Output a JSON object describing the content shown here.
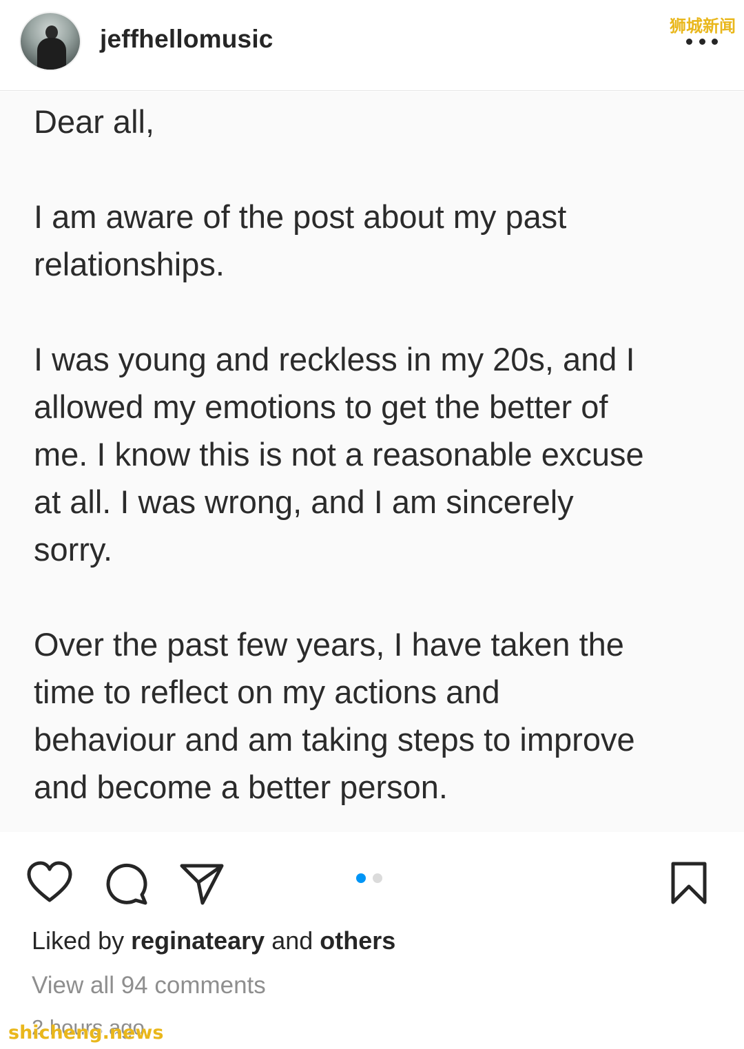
{
  "header": {
    "username": "jeffhellomusic",
    "watermark": "狮城新闻"
  },
  "post": {
    "text": "Dear all,\n\nI am aware of the post about my past\nrelationships.\n\nI was young and reckless in my 20s, and I\nallowed my emotions to get the better of\nme. I know this is not a reasonable excuse\nat all. I was wrong, and I am sincerely\nsorry.\n\nOver the past few years, I have taken the\ntime to reflect on my actions and\nbehaviour and am taking steps to improve\nand become a better person.",
    "carousel_position": 1,
    "carousel_total": 2
  },
  "actions": {
    "icons": [
      "heart-icon",
      "comment-icon",
      "share-icon",
      "bookmark-icon"
    ],
    "active_dot_color": "#0095f6"
  },
  "footer": {
    "liked_by_prefix": "Liked by ",
    "liked_by_user": "reginateary",
    "liked_by_middle": " and ",
    "liked_by_others": "others",
    "view_comments": "View all 94 comments",
    "timestamp": "2 hours ago",
    "watermark": "shicheng.news"
  }
}
